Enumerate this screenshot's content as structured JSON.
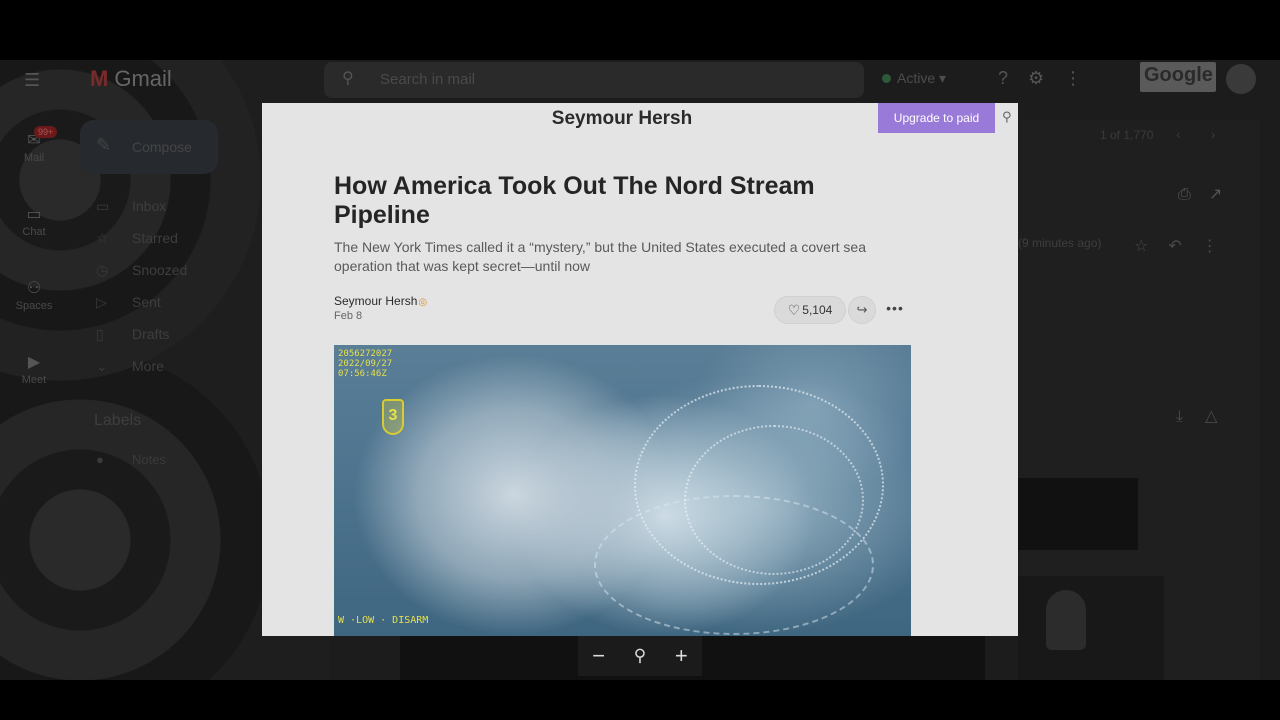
{
  "gmail": {
    "logo_text": "Gmail",
    "search_placeholder": "Search in mail",
    "status": "Active",
    "google_label": "Google",
    "compose": "Compose",
    "rail": [
      {
        "label": "Mail",
        "icon": "mail-icon"
      },
      {
        "label": "Chat",
        "icon": "chat-icon"
      },
      {
        "label": "Spaces",
        "icon": "spaces-icon"
      },
      {
        "label": "Meet",
        "icon": "meet-icon"
      }
    ],
    "mail_badge": "99+",
    "nav": [
      "Inbox",
      "Starred",
      "Snoozed",
      "Sent",
      "Drafts",
      "More"
    ],
    "labels_heading": "Labels",
    "label_items": [
      "Notes"
    ],
    "pagination": "1 of 1,770",
    "time_ago": "(9 minutes ago)"
  },
  "article": {
    "publication": "Seymour Hersh",
    "upgrade_label": "Upgrade to paid",
    "title": "How America Took Out The Nord Stream Pipeline",
    "subtitle": "The New York Times called it a “mystery,” but the United States executed a covert sea operation that was kept secret—until now",
    "author": "Seymour Hersh",
    "date": "Feb 8",
    "likes": "5,104",
    "image_osd_top": [
      "2056272027",
      "2022/09/27",
      "07:56:46Z"
    ],
    "image_osd_bottom": "W ·LOW    · DISARM",
    "image_emblem": "3"
  },
  "zoom": {
    "minus": "−",
    "plus": "+"
  }
}
